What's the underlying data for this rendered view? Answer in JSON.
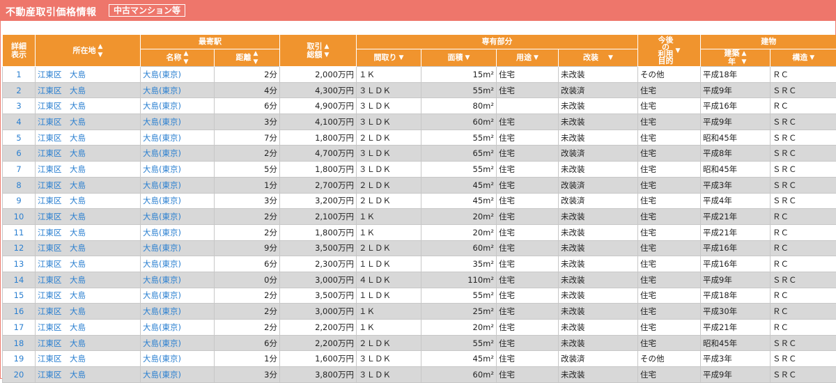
{
  "header": {
    "title": "不動産取引価格情報",
    "badge": "中古マンション等"
  },
  "columns": {
    "detail": "詳細\n表示",
    "location": "所在地",
    "station": "最寄駅",
    "station_name": "名称",
    "distance": "距離",
    "total": "取引\n総額",
    "exclusive": "専有部分",
    "layout": "間取り",
    "area": "面積",
    "use": "用途",
    "renovation": "改装",
    "future_use": "今後\nの\n利用\n目的",
    "building": "建物",
    "built_year": "建築\n年",
    "structure": "構造"
  },
  "rows": [
    {
      "no": "1",
      "loc": "江東区　大島",
      "st": "大島(東京)",
      "dist": "2分",
      "price": "2,000万円",
      "layout": "１Ｋ",
      "area": "15m²",
      "use": "住宅",
      "reno": "未改装",
      "purpose": "その他",
      "year": "平成18年",
      "struct": "ＲＣ"
    },
    {
      "no": "2",
      "loc": "江東区　大島",
      "st": "大島(東京)",
      "dist": "4分",
      "price": "4,300万円",
      "layout": "３ＬＤＫ",
      "area": "55m²",
      "use": "住宅",
      "reno": "改装済",
      "purpose": "住宅",
      "year": "平成9年",
      "struct": "ＳＲＣ"
    },
    {
      "no": "3",
      "loc": "江東区　大島",
      "st": "大島(東京)",
      "dist": "6分",
      "price": "4,900万円",
      "layout": "３ＬＤＫ",
      "area": "80m²",
      "use": "",
      "reno": "未改装",
      "purpose": "住宅",
      "year": "平成16年",
      "struct": "ＲＣ"
    },
    {
      "no": "4",
      "loc": "江東区　大島",
      "st": "大島(東京)",
      "dist": "3分",
      "price": "4,100万円",
      "layout": "３ＬＤＫ",
      "area": "60m²",
      "use": "住宅",
      "reno": "未改装",
      "purpose": "住宅",
      "year": "平成9年",
      "struct": "ＳＲＣ"
    },
    {
      "no": "5",
      "loc": "江東区　大島",
      "st": "大島(東京)",
      "dist": "7分",
      "price": "1,800万円",
      "layout": "２ＬＤＫ",
      "area": "55m²",
      "use": "住宅",
      "reno": "未改装",
      "purpose": "住宅",
      "year": "昭和45年",
      "struct": "ＳＲＣ"
    },
    {
      "no": "6",
      "loc": "江東区　大島",
      "st": "大島(東京)",
      "dist": "2分",
      "price": "4,700万円",
      "layout": "３ＬＤＫ",
      "area": "65m²",
      "use": "住宅",
      "reno": "改装済",
      "purpose": "住宅",
      "year": "平成8年",
      "struct": "ＳＲＣ"
    },
    {
      "no": "7",
      "loc": "江東区　大島",
      "st": "大島(東京)",
      "dist": "5分",
      "price": "1,800万円",
      "layout": "３ＬＤＫ",
      "area": "55m²",
      "use": "住宅",
      "reno": "未改装",
      "purpose": "住宅",
      "year": "昭和45年",
      "struct": "ＳＲＣ"
    },
    {
      "no": "8",
      "loc": "江東区　大島",
      "st": "大島(東京)",
      "dist": "1分",
      "price": "2,700万円",
      "layout": "２ＬＤＫ",
      "area": "45m²",
      "use": "住宅",
      "reno": "改装済",
      "purpose": "住宅",
      "year": "平成3年",
      "struct": "ＳＲＣ"
    },
    {
      "no": "9",
      "loc": "江東区　大島",
      "st": "大島(東京)",
      "dist": "3分",
      "price": "3,200万円",
      "layout": "２ＬＤＫ",
      "area": "45m²",
      "use": "住宅",
      "reno": "改装済",
      "purpose": "住宅",
      "year": "平成4年",
      "struct": "ＳＲＣ"
    },
    {
      "no": "10",
      "loc": "江東区　大島",
      "st": "大島(東京)",
      "dist": "2分",
      "price": "2,100万円",
      "layout": "１Ｋ",
      "area": "20m²",
      "use": "住宅",
      "reno": "未改装",
      "purpose": "住宅",
      "year": "平成21年",
      "struct": "ＲＣ"
    },
    {
      "no": "11",
      "loc": "江東区　大島",
      "st": "大島(東京)",
      "dist": "2分",
      "price": "1,800万円",
      "layout": "１Ｋ",
      "area": "20m²",
      "use": "住宅",
      "reno": "未改装",
      "purpose": "住宅",
      "year": "平成21年",
      "struct": "ＲＣ"
    },
    {
      "no": "12",
      "loc": "江東区　大島",
      "st": "大島(東京)",
      "dist": "9分",
      "price": "3,500万円",
      "layout": "２ＬＤＫ",
      "area": "60m²",
      "use": "住宅",
      "reno": "未改装",
      "purpose": "住宅",
      "year": "平成16年",
      "struct": "ＲＣ"
    },
    {
      "no": "13",
      "loc": "江東区　大島",
      "st": "大島(東京)",
      "dist": "6分",
      "price": "2,300万円",
      "layout": "１ＬＤＫ",
      "area": "35m²",
      "use": "住宅",
      "reno": "未改装",
      "purpose": "住宅",
      "year": "平成16年",
      "struct": "ＲＣ"
    },
    {
      "no": "14",
      "loc": "江東区　大島",
      "st": "大島(東京)",
      "dist": "0分",
      "price": "3,000万円",
      "layout": "４ＬＤＫ",
      "area": "110m²",
      "use": "住宅",
      "reno": "未改装",
      "purpose": "住宅",
      "year": "平成9年",
      "struct": "ＳＲＣ"
    },
    {
      "no": "15",
      "loc": "江東区　大島",
      "st": "大島(東京)",
      "dist": "2分",
      "price": "3,500万円",
      "layout": "１ＬＤＫ",
      "area": "55m²",
      "use": "住宅",
      "reno": "未改装",
      "purpose": "住宅",
      "year": "平成18年",
      "struct": "ＲＣ"
    },
    {
      "no": "16",
      "loc": "江東区　大島",
      "st": "大島(東京)",
      "dist": "2分",
      "price": "3,000万円",
      "layout": "１Ｋ",
      "area": "25m²",
      "use": "住宅",
      "reno": "未改装",
      "purpose": "住宅",
      "year": "平成30年",
      "struct": "ＲＣ"
    },
    {
      "no": "17",
      "loc": "江東区　大島",
      "st": "大島(東京)",
      "dist": "2分",
      "price": "2,200万円",
      "layout": "１Ｋ",
      "area": "20m²",
      "use": "住宅",
      "reno": "未改装",
      "purpose": "住宅",
      "year": "平成21年",
      "struct": "ＲＣ"
    },
    {
      "no": "18",
      "loc": "江東区　大島",
      "st": "大島(東京)",
      "dist": "6分",
      "price": "2,200万円",
      "layout": "２ＬＤＫ",
      "area": "55m²",
      "use": "住宅",
      "reno": "未改装",
      "purpose": "住宅",
      "year": "昭和45年",
      "struct": "ＳＲＣ"
    },
    {
      "no": "19",
      "loc": "江東区　大島",
      "st": "大島(東京)",
      "dist": "1分",
      "price": "1,600万円",
      "layout": "３ＬＤＫ",
      "area": "45m²",
      "use": "住宅",
      "reno": "改装済",
      "purpose": "その他",
      "year": "平成3年",
      "struct": "ＳＲＣ"
    },
    {
      "no": "20",
      "loc": "江東区　大島",
      "st": "大島(東京)",
      "dist": "3分",
      "price": "3,800万円",
      "layout": "３ＬＤＫ",
      "area": "60m²",
      "use": "住宅",
      "reno": "未改装",
      "purpose": "住宅",
      "year": "平成9年",
      "struct": "ＳＲＣ"
    }
  ]
}
